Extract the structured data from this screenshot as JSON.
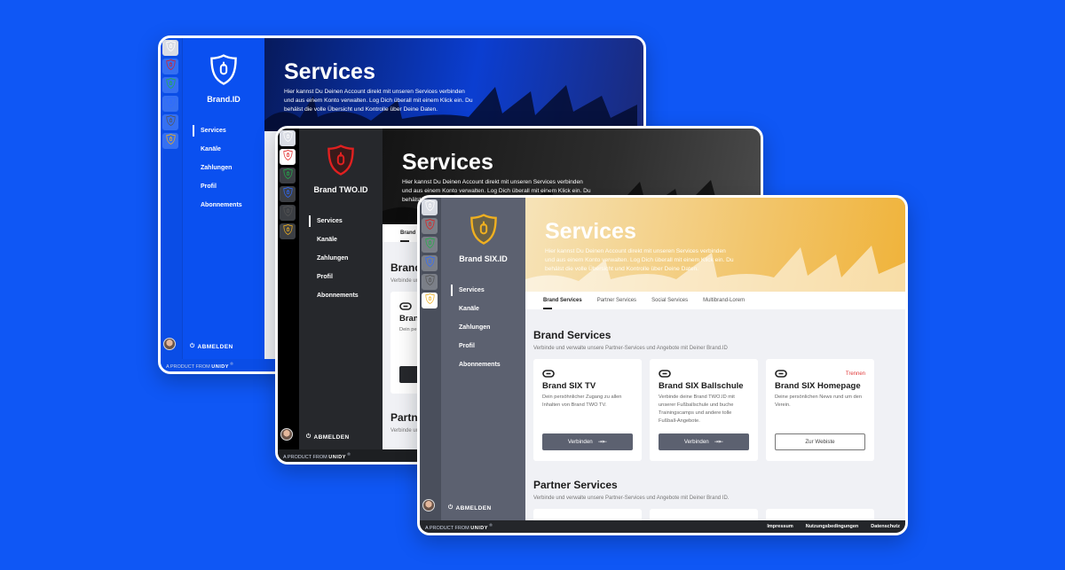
{
  "windows": [
    {
      "id": "brand-id",
      "brand_name": "Brand.ID",
      "accent": "#ffffff",
      "nav": [
        "Services",
        "Kanäle",
        "Zahlungen",
        "Profil",
        "Abonnements"
      ],
      "active_nav": 0,
      "logout": "ABMELDEN",
      "hero_title": "Services",
      "hero_text": "Hier kannst Du Deinen Account direkt mit unseren Services verbinden und aus einem Konto verwalten. Log Dich überall mit einem Klick ein. Du behälst die volle Übersicht und Kontrolle über Deine Daten.",
      "footer": {
        "prefix": "A PRODUCT FROM",
        "brand": "UNIDY",
        "reg": "®"
      }
    },
    {
      "id": "brand-two",
      "brand_name": "Brand TWO.ID",
      "accent": "#e02020",
      "nav": [
        "Services",
        "Kanäle",
        "Zahlungen",
        "Profil",
        "Abonnements"
      ],
      "active_nav": 0,
      "logout": "ABMELDEN",
      "hero_title": "Services",
      "hero_text": "Hier kannst Du Deinen Account direkt mit unseren Services verbinden und aus einem Konto verwalten. Log Dich überall mit einem Klick ein. Du behälst die volle Übersicht und Kontrolle über Deine Daten.",
      "tab_partial": "Brand S",
      "section_title_partial": "Brand",
      "section_sub_partial": "Verbinde un",
      "card_title_partial": "Bran",
      "card_text_partial": "Dein per Inhalten",
      "section2_partial": "Partn",
      "section2_sub_partial": "Verbinde un",
      "footer": {
        "prefix": "A PRODUCT FROM",
        "brand": "UNIDY",
        "reg": "®"
      }
    },
    {
      "id": "brand-six",
      "brand_name": "Brand SIX.ID",
      "accent": "#f0b020",
      "nav": [
        "Services",
        "Kanäle",
        "Zahlungen",
        "Profil",
        "Abonnements"
      ],
      "active_nav": 0,
      "logout": "ABMELDEN",
      "hero_title": "Services",
      "hero_text": "Hier kannst Du Deinen Account direkt mit unseren Services verbinden und aus einem Konto verwalten. Log Dich überall mit einem Klick ein. Du behälst die volle Übersicht und Kontrolle über Deine Daten.",
      "tabs": [
        "Brand Services",
        "Partner Services",
        "Social Services",
        "Multibrand-Lorem"
      ],
      "active_tab": 0,
      "brand_services": {
        "title": "Brand Services",
        "subtitle": "Verbinde und verwalte unsere Partner-Services und Angebote mit Deiner Brand.ID",
        "cards": [
          {
            "title": "Brand SIX TV",
            "text": "Dein persöhnlicher Zugang zu allen Inhalten von Brand TWO TV.",
            "button": "Verbinden",
            "button_icon": "connect-arrows-icon",
            "action": ""
          },
          {
            "title": "Brand SIX Ballschule",
            "text": "Verbinde deine Brand TWO.ID mit unserer Fußballschule und buche Trainingscamps und andere tolle Fußball-Angebote.",
            "button": "Verbinden",
            "button_icon": "connect-arrows-icon",
            "action": ""
          },
          {
            "title": "Brand SIX Homepage",
            "text": "Deine persönlichen News rund um den Verein.",
            "button": "Zur Webiste",
            "button_icon": "",
            "action": "Trennen"
          }
        ]
      },
      "partner_services": {
        "title": "Partner Services",
        "subtitle": "Verbinde und verwalte unsere Partner-Services und Angebote mit Deiner Brand ID."
      },
      "footer": {
        "prefix": "A PRODUCT FROM",
        "brand": "UNIDY",
        "reg": "®",
        "links": [
          "Impressum",
          "Nutzungsbedingungen",
          "Datenschutz"
        ]
      }
    }
  ],
  "brand_switcher_colors": [
    "#ffffff",
    "#e02020",
    "#22b04a",
    "#2f6bff",
    "#555555",
    "#f0b020"
  ]
}
